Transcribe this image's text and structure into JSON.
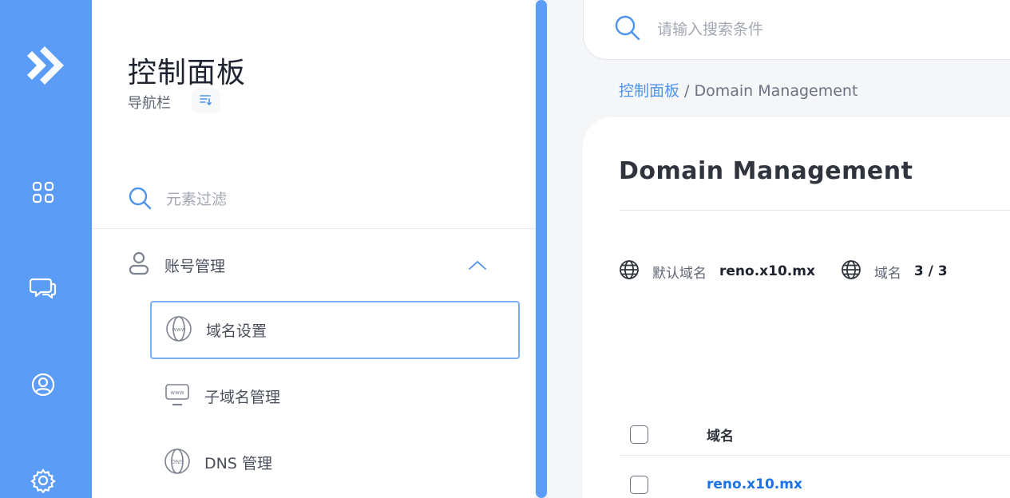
{
  "rail": {
    "icons": [
      "logo-arrow-icon",
      "apps-grid-icon",
      "chat-bubbles-icon",
      "user-circle-icon",
      "gear-icon"
    ],
    "accent": "#5b9cf6"
  },
  "nav": {
    "title": "控制面板",
    "subtitle": "导航栏",
    "filter_placeholder": "元素过滤",
    "group": {
      "label": "账号管理",
      "expanded": true
    },
    "items": [
      {
        "label": "域名设置",
        "icon": "www-globe-icon",
        "active": true
      },
      {
        "label": "子域名管理",
        "icon": "www-monitor-icon",
        "active": false
      },
      {
        "label": "DNS 管理",
        "icon": "dns-globe-icon",
        "active": false
      }
    ]
  },
  "main": {
    "search_placeholder": "请输入搜索条件",
    "breadcrumb": {
      "root": "控制面板",
      "separator": " / ",
      "current": "Domain Management"
    },
    "card": {
      "title": "Domain Management",
      "stats": [
        {
          "label": "默认域名",
          "value": "reno.x10.mx"
        },
        {
          "label": "域名",
          "value": "3 / 3"
        }
      ],
      "table": {
        "header": "域名",
        "rows": [
          {
            "domain": "reno.x10.mx"
          }
        ]
      }
    },
    "link_color": "#1a73e8"
  }
}
